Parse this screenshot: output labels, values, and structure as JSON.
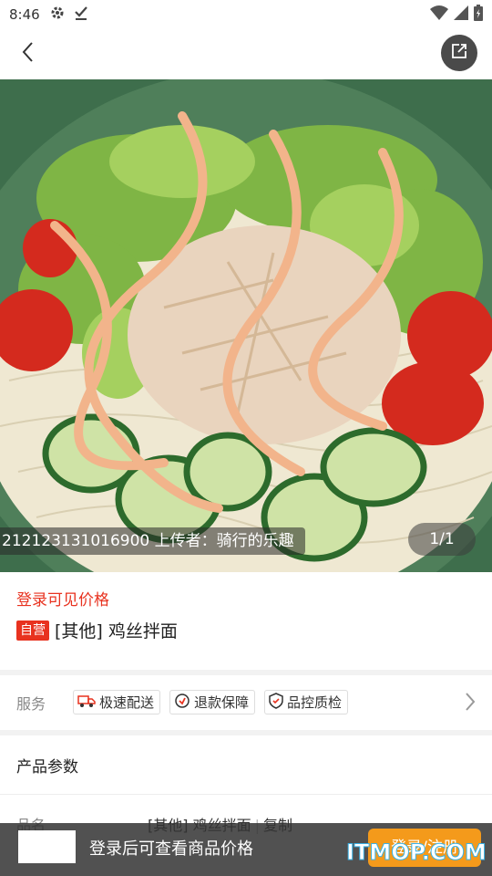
{
  "status_bar": {
    "time": "8:46",
    "icons_left": [
      "gear-icon",
      "download-done-icon"
    ],
    "icons_right": [
      "wifi-icon",
      "signal-icon",
      "battery-icon"
    ]
  },
  "header": {
    "back_icon": "chevron-left-icon",
    "share_icon": "share-icon"
  },
  "hero": {
    "caption": "212123131016900 上传者：骑行的乐趣",
    "page_indicator": "1/1"
  },
  "product": {
    "login_price": "登录可见价格",
    "self_badge": "自营",
    "title": "[其他] 鸡丝拌面"
  },
  "service": {
    "label": "服务",
    "tags": [
      {
        "icon": "delivery-truck-icon",
        "label": "极速配送"
      },
      {
        "icon": "refund-icon",
        "label": "退款保障"
      },
      {
        "icon": "shield-check-icon",
        "label": "品控质检"
      }
    ]
  },
  "params": {
    "title": "产品参数",
    "rows": [
      {
        "name": "品名",
        "value": "[其他] 鸡丝拌面",
        "action": "复制"
      }
    ]
  },
  "bottom_bar": {
    "text": "登录后可查看商品价格",
    "button": "登录/注册"
  },
  "watermark": {
    "brand_a": "IT",
    "brand_b": "MOP",
    "brand_c": ".COM"
  },
  "colors": {
    "accent_red": "#e8321f",
    "button_orange": "#f49a1b",
    "watermark_blue": "#3ab2e6"
  }
}
